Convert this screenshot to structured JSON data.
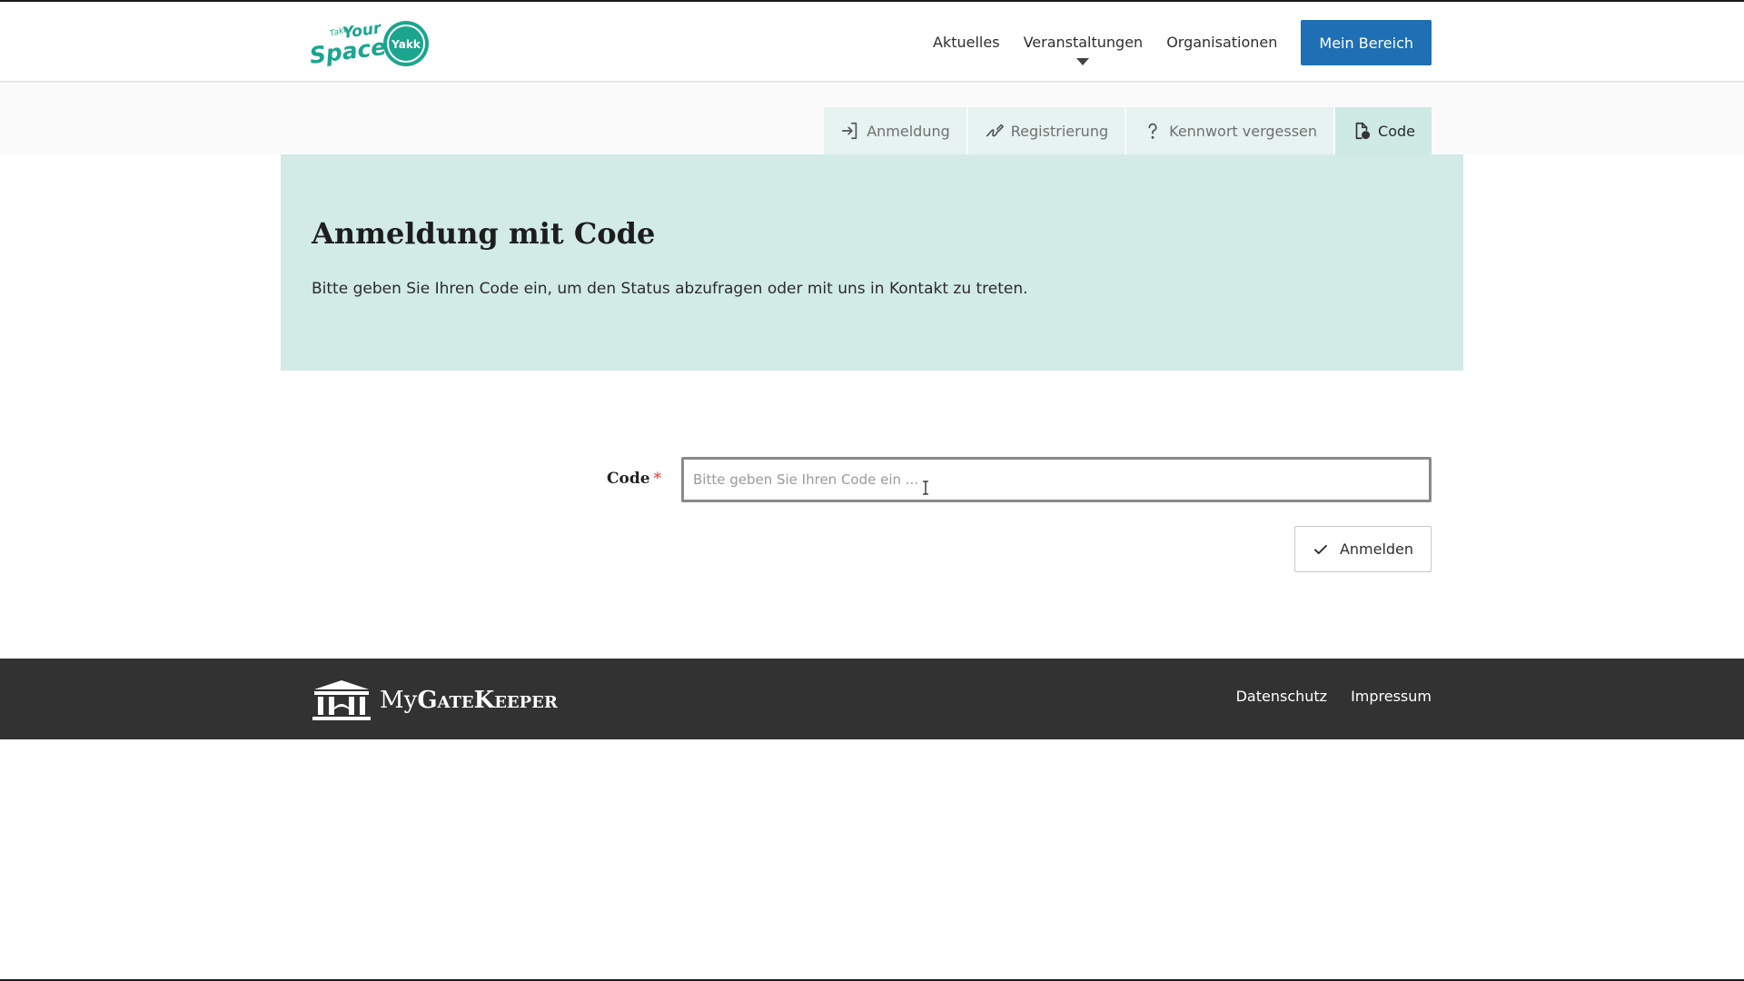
{
  "header": {
    "logo_text": "Take Your Space",
    "nav": [
      {
        "label": "Aktuelles"
      },
      {
        "label": "Veranstaltungen",
        "has_dropdown": true
      },
      {
        "label": "Organisationen"
      }
    ],
    "cta_label": "Mein Bereich"
  },
  "tabs": [
    {
      "label": "Anmeldung",
      "icon": "sign-in-icon",
      "active": false
    },
    {
      "label": "Registrierung",
      "icon": "signature-icon",
      "active": false
    },
    {
      "label": "Kennwort vergessen",
      "icon": "question-icon",
      "active": false
    },
    {
      "label": "Code",
      "icon": "file-code-icon",
      "active": true
    }
  ],
  "hero": {
    "title": "Anmeldung mit Code",
    "description": "Bitte geben Sie Ihren Code ein, um den Status abzufragen oder mit uns in Kontakt zu treten."
  },
  "form": {
    "code_label": "Code",
    "required_mark": "*",
    "code_placeholder": "Bitte geben Sie Ihren Code ein ...",
    "code_value": "",
    "submit_label": "Anmelden"
  },
  "footer": {
    "brand_prefix": "My",
    "brand_main": "GateKeeper",
    "links": [
      {
        "label": "Datenschutz"
      },
      {
        "label": "Impressum"
      }
    ]
  },
  "colors": {
    "accent_blue": "#1f6fb5",
    "hero_bg": "#d2ebe7",
    "tab_bg": "#e6f3f1",
    "tab_active_bg": "#cfe9e5",
    "footer_bg": "#323232",
    "logo_teal": "#1ba58f"
  }
}
